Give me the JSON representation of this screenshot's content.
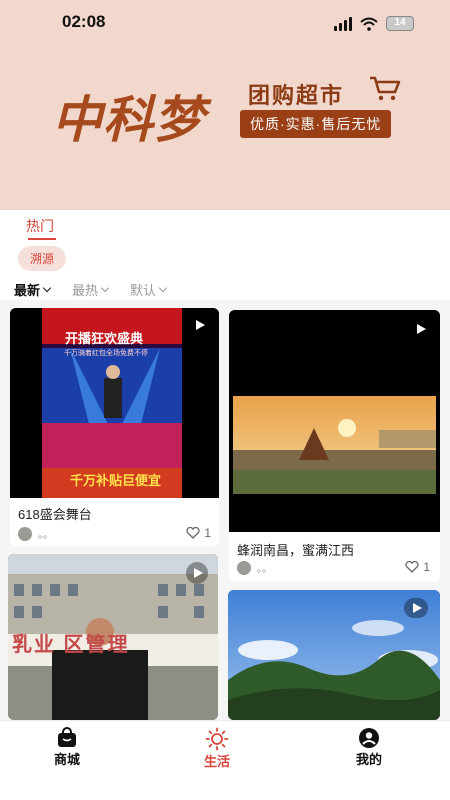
{
  "status_bar": {
    "time": "02:08",
    "battery": "14"
  },
  "banner": {
    "brand": "中科梦",
    "tagline": "团购超市",
    "slogan": "优质·实惠·售后无忧"
  },
  "tabs": {
    "hot": "热门"
  },
  "chip": "溯源",
  "filters": [
    {
      "label": "最新",
      "active": true
    },
    {
      "label": "最热",
      "active": false
    },
    {
      "label": "默认",
      "active": false
    }
  ],
  "cards": [
    {
      "title": "618盛会舞台",
      "overlay_top": "开播狂欢盛典",
      "overlay_sub": "千万骑着红包全场免费不停",
      "overlay_bottom": "千万补贴巨便宜",
      "author": "。。",
      "likes": "1"
    },
    {
      "title": "蜂润南昌，蜜满江西",
      "author": "。。",
      "likes": "1"
    },
    {
      "title": "",
      "overlay_sign": "乳业 区管理"
    },
    {
      "title": ""
    }
  ],
  "nav": [
    {
      "label": "商城",
      "icon": "shopping-bag-icon",
      "active": false
    },
    {
      "label": "生活",
      "icon": "sun-icon",
      "active": true
    },
    {
      "label": "我的",
      "icon": "user-icon",
      "active": false
    }
  ],
  "colors": {
    "accent": "#d9463a",
    "brand": "#a64a1d",
    "banner_bg": "#f2d8cc"
  }
}
